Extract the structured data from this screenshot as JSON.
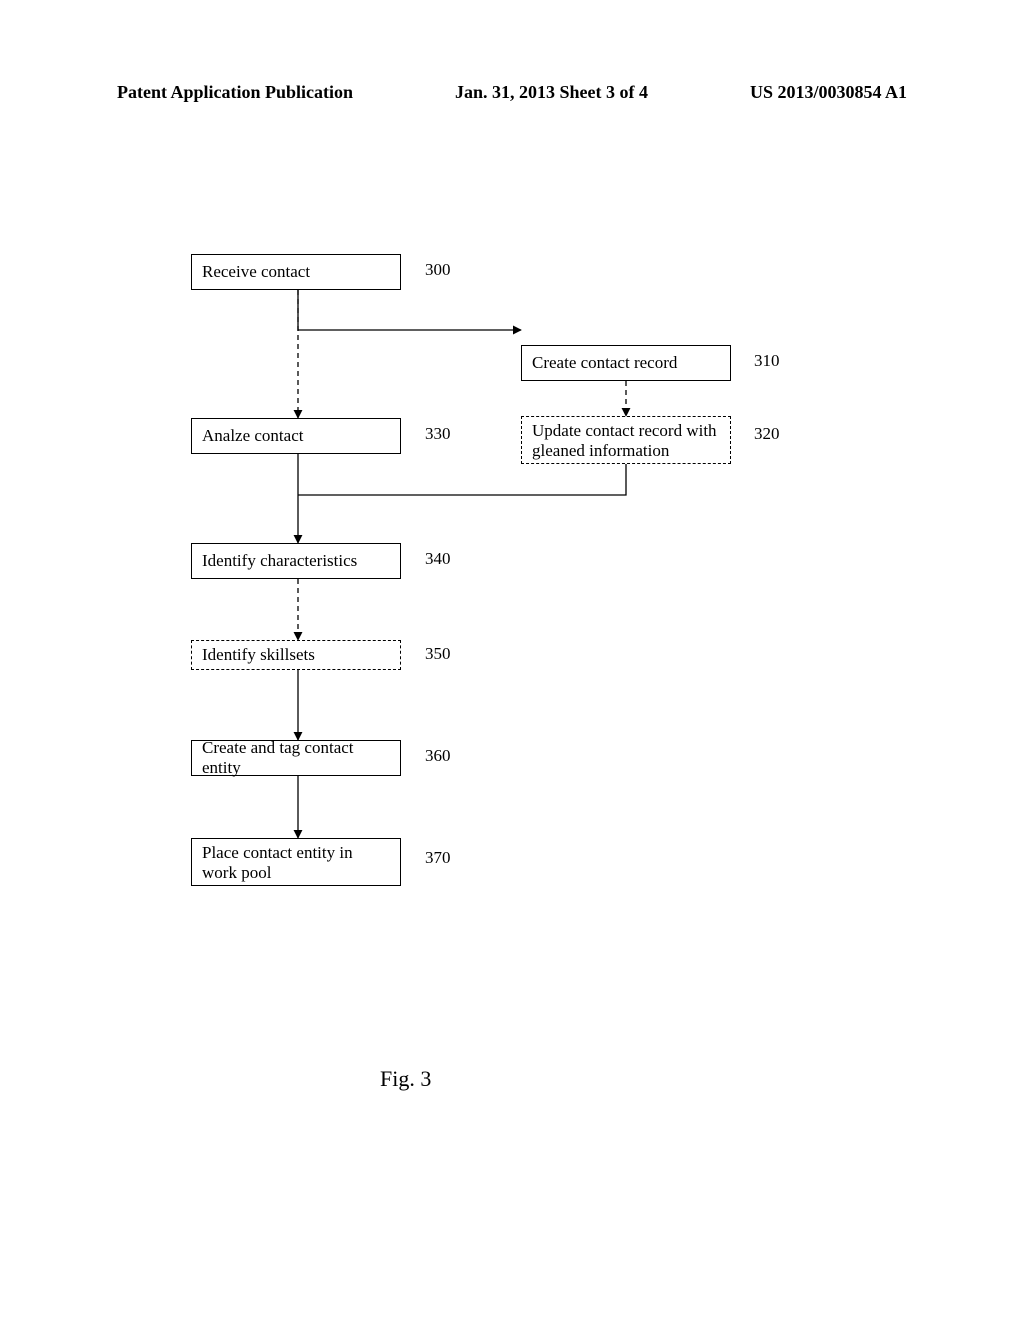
{
  "header": {
    "left": "Patent Application Publication",
    "center": "Jan. 31, 2013  Sheet 3 of 4",
    "right": "US 2013/0030854 A1"
  },
  "boxes": {
    "b300": {
      "text": "Receive contact",
      "ref": "300"
    },
    "b310": {
      "text": "Create contact record",
      "ref": "310"
    },
    "b320": {
      "text": "Update contact record with gleaned information",
      "ref": "320"
    },
    "b330": {
      "text": "Analze contact",
      "ref": "330"
    },
    "b340": {
      "text": "Identify characteristics",
      "ref": "340"
    },
    "b350": {
      "text": "Identify skillsets",
      "ref": "350"
    },
    "b360": {
      "text": "Create and tag contact entity",
      "ref": "360"
    },
    "b370": {
      "text": "Place contact entity in work pool",
      "ref": "370"
    }
  },
  "figure": "Fig. 3",
  "chart_data": {
    "type": "flowchart",
    "nodes": [
      {
        "id": "300",
        "label": "Receive contact",
        "style": "solid"
      },
      {
        "id": "310",
        "label": "Create contact record",
        "style": "solid"
      },
      {
        "id": "320",
        "label": "Update contact record with gleaned information",
        "style": "dashed"
      },
      {
        "id": "330",
        "label": "Analze contact",
        "style": "solid"
      },
      {
        "id": "340",
        "label": "Identify characteristics",
        "style": "solid"
      },
      {
        "id": "350",
        "label": "Identify skillsets",
        "style": "dashed"
      },
      {
        "id": "360",
        "label": "Create and tag contact entity",
        "style": "solid"
      },
      {
        "id": "370",
        "label": "Place contact entity in work pool",
        "style": "solid"
      }
    ],
    "edges": [
      {
        "from": "300",
        "to": "310",
        "style": "solid"
      },
      {
        "from": "300",
        "to": "330",
        "style": "dashed"
      },
      {
        "from": "310",
        "to": "320",
        "style": "dashed"
      },
      {
        "from": "320",
        "to": "330_join",
        "style": "solid"
      },
      {
        "from": "330",
        "to": "340",
        "style": "solid"
      },
      {
        "from": "340",
        "to": "350",
        "style": "dashed"
      },
      {
        "from": "350",
        "to": "360",
        "style": "solid"
      },
      {
        "from": "360",
        "to": "370",
        "style": "solid"
      }
    ]
  }
}
